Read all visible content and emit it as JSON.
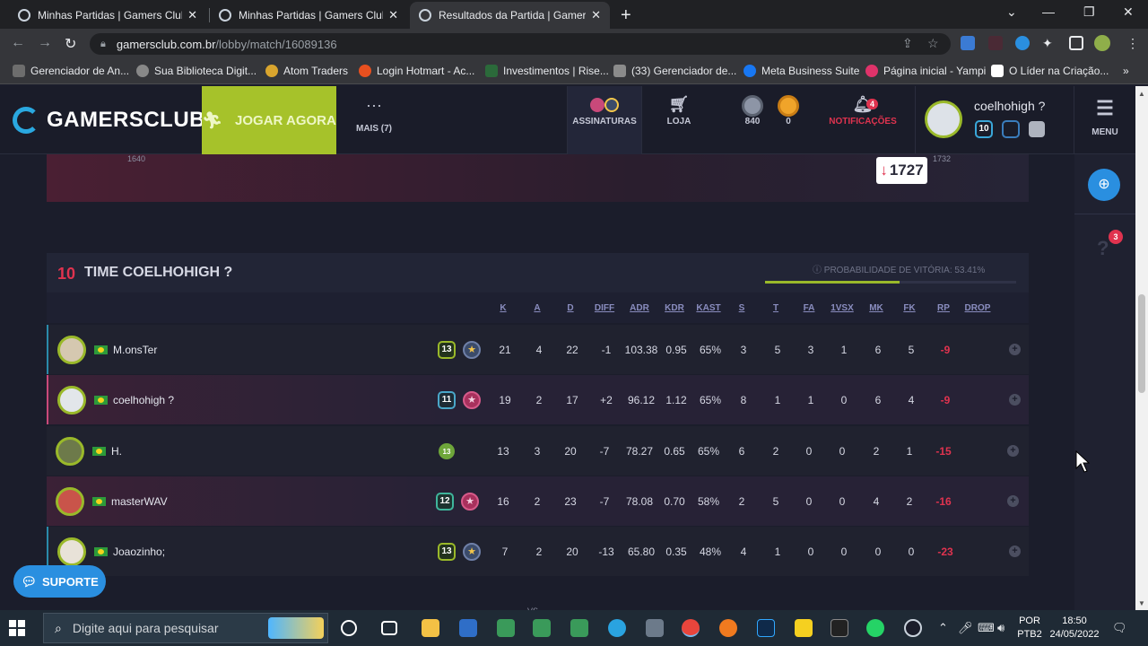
{
  "browser": {
    "tabs": [
      {
        "label": "Minhas Partidas | Gamers Club. A"
      },
      {
        "label": "Minhas Partidas | Gamers Club. A"
      },
      {
        "label": "Resultados da Partida | Gamers C"
      }
    ],
    "url_host": "gamersclub.com.br",
    "url_path": "/lobby/match/16089136",
    "bookmarks": [
      "Gerenciador de An...",
      "Sua Biblioteca Digit...",
      "Atom Traders",
      "Login Hotmart - Ac...",
      "Investimentos | Rise...",
      "(33) Gerenciador de...",
      "Meta Business Suite",
      "Página inicial - Yampi",
      "O Líder na Criação..."
    ]
  },
  "header": {
    "logo_text": "GAMERSCLUB",
    "play_label": "JOGAR AGORA",
    "more_label": "MAIS (7)",
    "subs_label": "ASSINATURAS",
    "shop_label": "LOJA",
    "coins_silver": "840",
    "coins_gold": "0",
    "notif_count": "4",
    "notif_label": "NOTIFICAÇÕES",
    "username": "coelhohigh ?",
    "user_level": "10",
    "menu_label": "MENU"
  },
  "prev_panel": {
    "left_value": "1640",
    "right_value": "1732",
    "elo_popup": "1727",
    "elo_arrow": "↓"
  },
  "team": {
    "level": "10",
    "name": "TIME COELHOHIGH ?",
    "win_prob_label": "PROBABILIDADE DE VITÓRIA: 53.41%",
    "win_prob": 0.5341
  },
  "columns": [
    "K",
    "A",
    "D",
    "DIFF",
    "ADR",
    "KDR",
    "KAST",
    "S",
    "T",
    "FA",
    "1VSX",
    "MK",
    "FK",
    "RP",
    "DROP"
  ],
  "players": [
    {
      "name": "M.onsTer",
      "level": "13",
      "stats": [
        "21",
        "4",
        "22",
        "-1",
        "103.38",
        "0.95",
        "65%",
        "3",
        "5",
        "3",
        "1",
        "6",
        "5",
        "-9"
      ]
    },
    {
      "name": "coelhohigh ?",
      "level": "11",
      "stats": [
        "19",
        "2",
        "17",
        "+2",
        "96.12",
        "1.12",
        "65%",
        "8",
        "1",
        "1",
        "0",
        "6",
        "4",
        "-9"
      ]
    },
    {
      "name": "H.",
      "level": "13",
      "stats": [
        "13",
        "3",
        "20",
        "-7",
        "78.27",
        "0.65",
        "65%",
        "6",
        "2",
        "0",
        "0",
        "2",
        "1",
        "-15"
      ]
    },
    {
      "name": "masterWAV",
      "level": "12",
      "stats": [
        "16",
        "2",
        "23",
        "-7",
        "78.08",
        "0.70",
        "58%",
        "2",
        "5",
        "0",
        "0",
        "4",
        "2",
        "-16"
      ]
    },
    {
      "name": "Joaozinho;",
      "level": "13",
      "stats": [
        "7",
        "2",
        "20",
        "-13",
        "65.80",
        "0.35",
        "48%",
        "4",
        "1",
        "0",
        "0",
        "0",
        "0",
        "-23"
      ]
    }
  ],
  "support_label": "SUPORTE",
  "peek_text": "VS",
  "rail": {
    "help_badge": "3"
  },
  "taskbar": {
    "search_placeholder": "Digite aqui para pesquisar",
    "lang_line1": "POR",
    "lang_line2": "PTB2",
    "time": "18:50",
    "date": "24/05/2022"
  }
}
